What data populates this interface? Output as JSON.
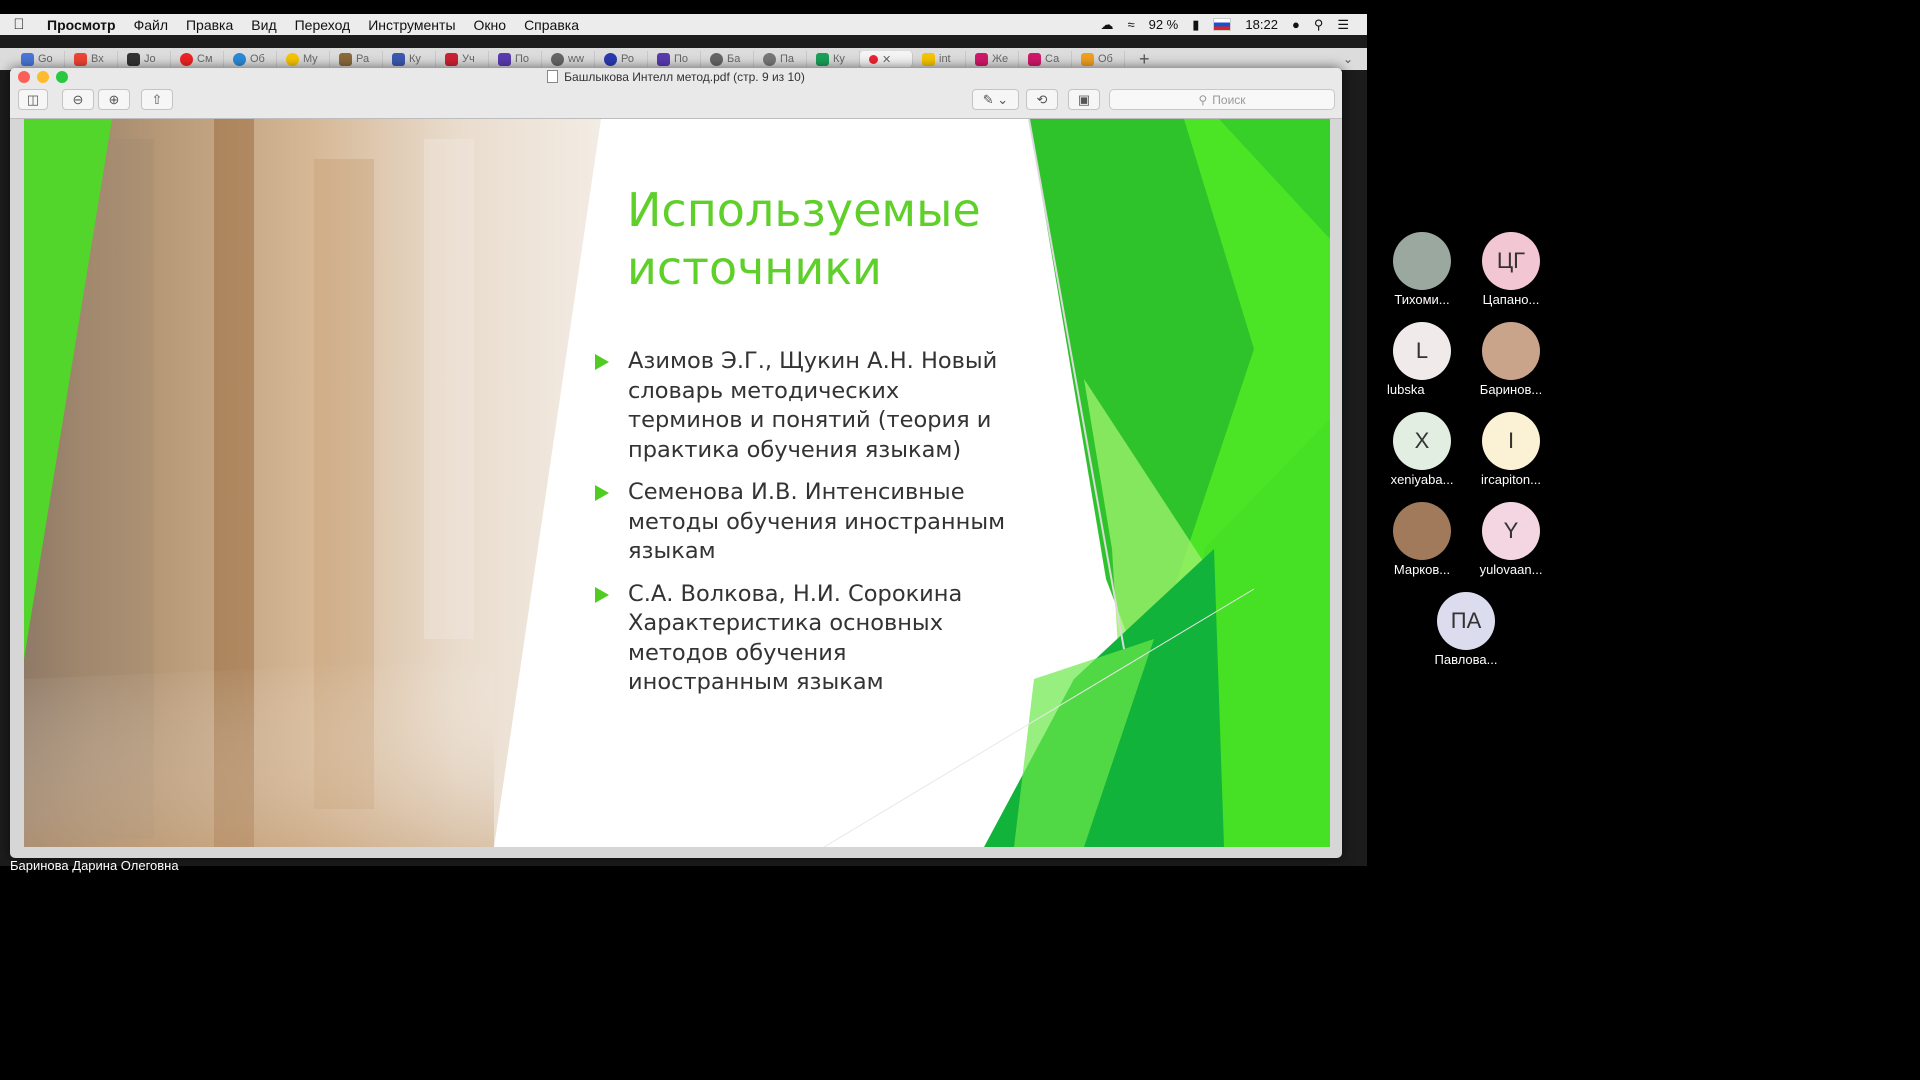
{
  "menubar": {
    "app": "Просмотр",
    "items": [
      "Файл",
      "Правка",
      "Вид",
      "Переход",
      "Инструменты",
      "Окно",
      "Справка"
    ],
    "battery": "92 %",
    "clock": "18:22"
  },
  "tabs": [
    "Go",
    "Вх",
    "Jo",
    "См",
    "Об",
    "My",
    "Ра",
    "Ку",
    "Уч",
    "По",
    "ww",
    "Ро",
    "По",
    "Ба",
    "Па",
    "Ку",
    "",
    "int",
    "Же",
    "Са",
    "Об"
  ],
  "window": {
    "title": "Башлыкова Интелл метод.pdf (стр. 9 из 10)",
    "search_placeholder": "Поиск"
  },
  "slide": {
    "title": "Используемые источники",
    "bullets": [
      "Азимов Э.Г., Щукин А.Н. Новый словарь методических терминов и понятий (теория и практика обучения языкам)",
      "Семенова И.В.  Интенсивные методы обучения иностранным языкам",
      "С.А. Волкова, Н.И. Сорокина Характеристика основных методов обучения иностранным языкам"
    ]
  },
  "presenter_caption": "Баринова Дарина Олеговна",
  "participants": [
    {
      "initials": "",
      "name": "Тихоми...",
      "color": "#9aa8a0"
    },
    {
      "initials": "ЦГ",
      "name": "Цапано...",
      "color": "#f3c6d3"
    },
    {
      "initials": "L",
      "name": "lubska",
      "color": "#f0eaea"
    },
    {
      "initials": "",
      "name": "Баринов...",
      "color": "#c9a48b"
    },
    {
      "initials": "X",
      "name": "xeniyaba...",
      "color": "#e3eee3"
    },
    {
      "initials": "I",
      "name": "ircapiton...",
      "color": "#fbf1d5"
    },
    {
      "initials": "",
      "name": "Марков...",
      "color": "#a07a5a"
    },
    {
      "initials": "Y",
      "name": "yulovaan...",
      "color": "#f4d6e2"
    },
    {
      "initials": "ПА",
      "name": "Павлова...",
      "color": "#dcdcef"
    }
  ],
  "colors": {
    "accent_green": "#5fcf2a",
    "highlight": "#4b4fa8"
  }
}
